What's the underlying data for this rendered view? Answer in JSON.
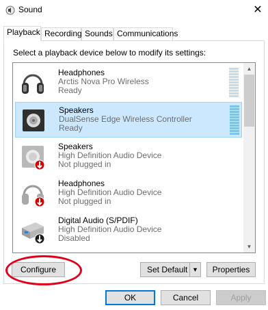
{
  "window": {
    "title": "Sound"
  },
  "tabs": [
    {
      "label": "Playback",
      "active": true
    },
    {
      "label": "Recording",
      "active": false
    },
    {
      "label": "Sounds",
      "active": false
    },
    {
      "label": "Communications",
      "active": false
    }
  ],
  "instruction": "Select a playback device below to modify its settings:",
  "devices": [
    {
      "name": "Headphones",
      "description": "Arctis Nova Pro Wireless",
      "status": "Ready",
      "icon": "headphones-icon",
      "selected": false
    },
    {
      "name": "Speakers",
      "description": "DualSense Edge Wireless Controller",
      "status": "Ready",
      "icon": "speaker-icon",
      "selected": true
    },
    {
      "name": "Speakers",
      "description": "High Definition Audio Device",
      "status": "Not plugged in",
      "icon": "speaker-icon",
      "selected": false
    },
    {
      "name": "Headphones",
      "description": "High Definition Audio Device",
      "status": "Not plugged in",
      "icon": "headphones-icon",
      "selected": false
    },
    {
      "name": "Digital Audio (S/PDIF)",
      "description": "High Definition Audio Device",
      "status": "Disabled",
      "icon": "digital-audio-icon",
      "selected": false
    }
  ],
  "buttons": {
    "configure": "Configure",
    "set_default": "Set Default",
    "properties": "Properties",
    "ok": "OK",
    "cancel": "Cancel",
    "apply": "Apply"
  },
  "colors": {
    "selection": "#cce8ff",
    "annotation": "#e0001b",
    "accent": "#0078d7"
  }
}
